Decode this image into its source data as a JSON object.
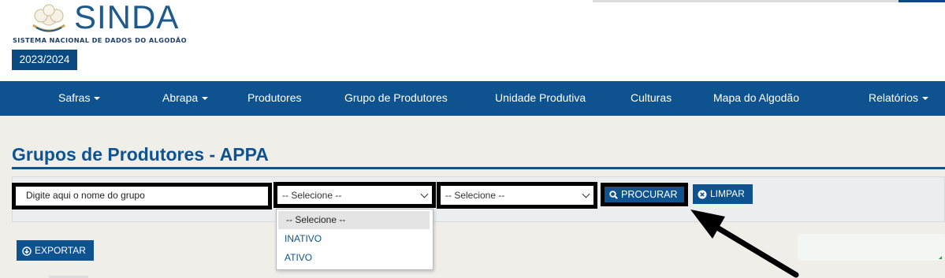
{
  "brand": {
    "logo_text": "SINDA",
    "tagline": "SISTEMA NACIONAL DE DADOS DO ALGODÃO",
    "season": "2023/2024"
  },
  "nav": {
    "items": [
      {
        "label": "Safras",
        "dropdown": true
      },
      {
        "label": "Abrapa",
        "dropdown": true
      },
      {
        "label": "Produtores",
        "dropdown": false
      },
      {
        "label": "Grupo de Produtores",
        "dropdown": false
      },
      {
        "label": "Unidade Produtiva",
        "dropdown": false
      },
      {
        "label": "Culturas",
        "dropdown": false
      },
      {
        "label": "Mapa do Algodão",
        "dropdown": false
      },
      {
        "label": "Relatórios",
        "dropdown": true
      }
    ]
  },
  "page": {
    "title": "Grupos de Produtores - APPA"
  },
  "filters": {
    "search_placeholder": "Digite aqui o nome do grupo",
    "select_status_value": "-- Selecione --",
    "select_second_value": "-- Selecione --",
    "status_options": [
      "-- Selecione --",
      "INATIVO",
      "ATIVO"
    ],
    "search_button": "PROCURAR",
    "clear_button": "LIMPAR"
  },
  "actions": {
    "export_button": "EXPORTAR"
  },
  "colors": {
    "primary": "#0e538f",
    "highlight_border": "#000000",
    "background": "#f0eee9"
  },
  "icons": {
    "search": "search-icon",
    "clear": "close-circle-icon",
    "export": "download-circle-icon",
    "dropdown": "chevron-down-icon"
  }
}
